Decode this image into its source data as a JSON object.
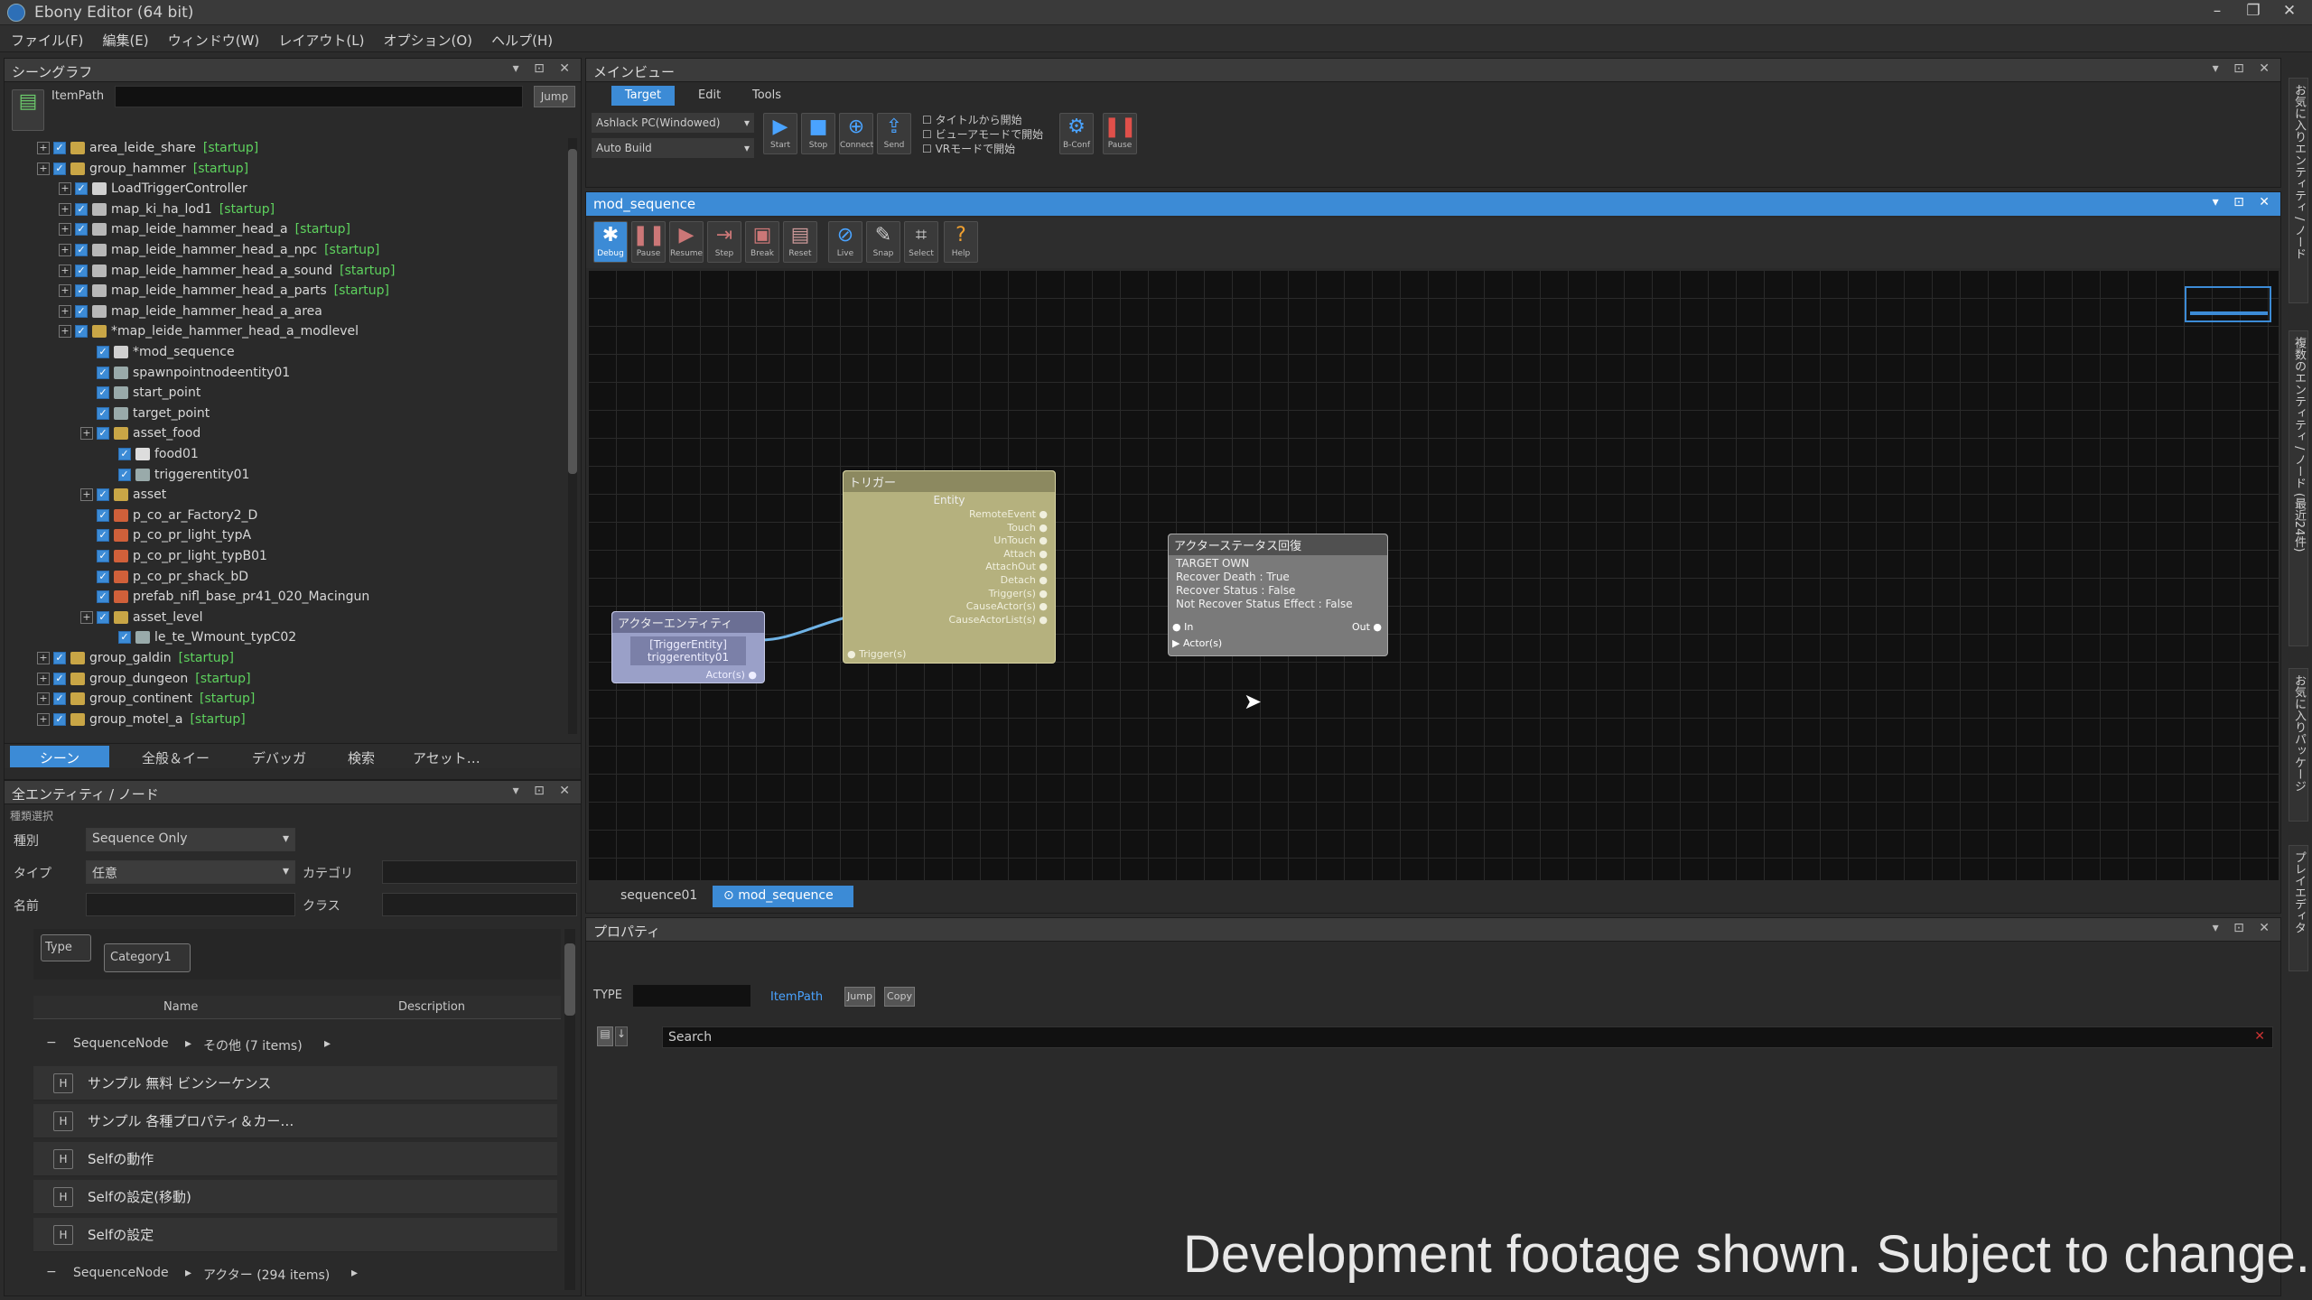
{
  "window": {
    "title": "Ebony Editor (64 bit)",
    "controls": [
      "–",
      "❐",
      "✕"
    ]
  },
  "menu": [
    "ファイル(F)",
    "編集(E)",
    "ウィンドウ(W)",
    "レイアウト(L)",
    "オプション(O)",
    "ヘルプ(H)"
  ],
  "scene_graph": {
    "title": "シーングラフ",
    "item_path_label": "ItemPath",
    "jump_label": "Jump",
    "tree": [
      {
        "label": "area_leide_share",
        "tag": "[startup]",
        "depth": 0,
        "icon": "folder"
      },
      {
        "label": "group_hammer",
        "tag": "[startup]",
        "depth": 0,
        "icon": "folder"
      },
      {
        "label": "LoadTriggerController",
        "tag": "",
        "depth": 1,
        "icon": "gear"
      },
      {
        "label": "map_ki_ha_lod1",
        "tag": "[startup]",
        "depth": 1,
        "icon": "file"
      },
      {
        "label": "map_leide_hammer_head_a",
        "tag": "[startup]",
        "depth": 1,
        "icon": "file"
      },
      {
        "label": "map_leide_hammer_head_a_npc",
        "tag": "[startup]",
        "depth": 1,
        "icon": "file"
      },
      {
        "label": "map_leide_hammer_head_a_sound",
        "tag": "[startup]",
        "depth": 1,
        "icon": "file"
      },
      {
        "label": "map_leide_hammer_head_a_parts",
        "tag": "[startup]",
        "depth": 1,
        "icon": "file"
      },
      {
        "label": "map_leide_hammer_head_a_area",
        "tag": "",
        "depth": 1,
        "icon": "file"
      },
      {
        "label": "*map_leide_hammer_head_a_modlevel",
        "tag": "",
        "depth": 1,
        "icon": "folder"
      },
      {
        "label": "*mod_sequence",
        "tag": "",
        "depth": 2,
        "icon": "gear"
      },
      {
        "label": "spawnpointnodeentity01",
        "tag": "",
        "depth": 2,
        "icon": "point"
      },
      {
        "label": "start_point",
        "tag": "",
        "depth": 2,
        "icon": "point"
      },
      {
        "label": "target_point",
        "tag": "",
        "depth": 2,
        "icon": "point"
      },
      {
        "label": "asset_food",
        "tag": "",
        "depth": 2,
        "icon": "folder"
      },
      {
        "label": "food01",
        "tag": "",
        "depth": 3,
        "icon": "doc"
      },
      {
        "label": "triggerentity01",
        "tag": "",
        "depth": 3,
        "icon": "point"
      },
      {
        "label": "asset",
        "tag": "",
        "depth": 2,
        "icon": "folder"
      },
      {
        "label": "p_co_ar_Factory2_D",
        "tag": "",
        "depth": 2,
        "icon": "model"
      },
      {
        "label": "p_co_pr_light_typA",
        "tag": "",
        "depth": 2,
        "icon": "model"
      },
      {
        "label": "p_co_pr_light_typB01",
        "tag": "",
        "depth": 2,
        "icon": "model"
      },
      {
        "label": "p_co_pr_shack_bD",
        "tag": "",
        "depth": 2,
        "icon": "model"
      },
      {
        "label": "prefab_nifl_base_pr41_020_Macingun",
        "tag": "",
        "depth": 2,
        "icon": "model"
      },
      {
        "label": "asset_level",
        "tag": "",
        "depth": 2,
        "icon": "folder"
      },
      {
        "label": "le_te_Wmount_typC02",
        "tag": "",
        "depth": 3,
        "icon": "point"
      },
      {
        "label": "group_galdin",
        "tag": "[startup]",
        "depth": 0,
        "icon": "folder"
      },
      {
        "label": "group_dungeon",
        "tag": "[startup]",
        "depth": 0,
        "icon": "folder"
      },
      {
        "label": "group_continent",
        "tag": "[startup]",
        "depth": 0,
        "icon": "folder"
      },
      {
        "label": "group_motel_a",
        "tag": "[startup]",
        "depth": 0,
        "icon": "folder"
      }
    ],
    "bottom_tabs": [
      "シーン",
      "全般＆イー",
      "デバッガ",
      "検索",
      "アセット…"
    ]
  },
  "entity_panel": {
    "title": "全エンティティ / ノード",
    "section": "種類選択",
    "kind_label": "種別",
    "kind_value": "Sequence Only",
    "type_label": "タイプ",
    "type_value": "任意",
    "category_label": "カテゴリ",
    "name_label": "名前",
    "class_label": "クラス",
    "group_chips": [
      "Type",
      "Category1"
    ],
    "columns": [
      "Name",
      "Description"
    ],
    "group1": {
      "node": "SequenceNode",
      "name": "その他 (7 items)"
    },
    "rows": [
      "サンプル 無料 ビンシーケンス",
      "サンプル 各種プロパティ＆カー…",
      "Selfの動作",
      "Selfの設定(移動)",
      "Selfの設定"
    ],
    "group2": {
      "node": "SequenceNode",
      "name": "アクター (294 items)"
    }
  },
  "main_view": {
    "title": "メインビュー",
    "tabs": [
      "Target",
      "Edit",
      "Tools"
    ],
    "target_select": "Ashlack PC(Windowed)",
    "build_select": "Auto Build",
    "buttons": [
      "Start",
      "Stop",
      "Connect",
      "Send",
      "B-Conf",
      "Pause"
    ],
    "options": [
      "タイトルから開始",
      "ビューアモードで開始",
      "VRモードで開始"
    ]
  },
  "sequence_editor": {
    "title": "mod_sequence",
    "tools": [
      "Debug",
      "Pause",
      "Resume",
      "Step",
      "Break",
      "Reset",
      "Live",
      "Snap",
      "Select",
      "Help"
    ],
    "nodes": {
      "actor_entity": {
        "title": "アクターエンティティ",
        "lines": [
          "[TriggerEntity]",
          "triggerentity01"
        ],
        "port": "Actor(s)"
      },
      "trigger": {
        "title": "トリガー",
        "header": "Entity",
        "outputs": [
          "RemoteEvent",
          "Touch",
          "UnTouch",
          "Attach",
          "AttachOut",
          "Detach",
          "Trigger(s)",
          "CauseActor(s)",
          "CauseActorList(s)"
        ],
        "input": "Trigger(s)"
      },
      "actor_status": {
        "title": "アクターステータス回復",
        "lines": [
          "TARGET OWN",
          "Recover Death : True",
          "Recover Status : False",
          "Not Recover Status Effect : False"
        ],
        "in": "In",
        "out": "Out",
        "actor": "Actor(s)"
      }
    },
    "bottom_tabs": [
      "sequence01",
      "mod_sequence"
    ]
  },
  "properties": {
    "title": "プロパティ",
    "type_label": "TYPE",
    "item_path_label": "ItemPath",
    "jump_label": "Jump",
    "copy_label": "Copy",
    "search_placeholder": "Search"
  },
  "side_tabs": [
    "お気に入りエンティティ / ノード",
    "複数のエンティティ / ノード (最近24件)",
    "お気に入りパッケージ",
    "プレイエディタ"
  ],
  "caption": "Development footage shown. Subject to change.",
  "colors": {
    "accent": "#3c8bd6",
    "startup_tag": "#5ed35e",
    "trigger_node": "#b5b17e",
    "actor_node": "#9aa0c8",
    "status_node": "#8a8a8a"
  }
}
